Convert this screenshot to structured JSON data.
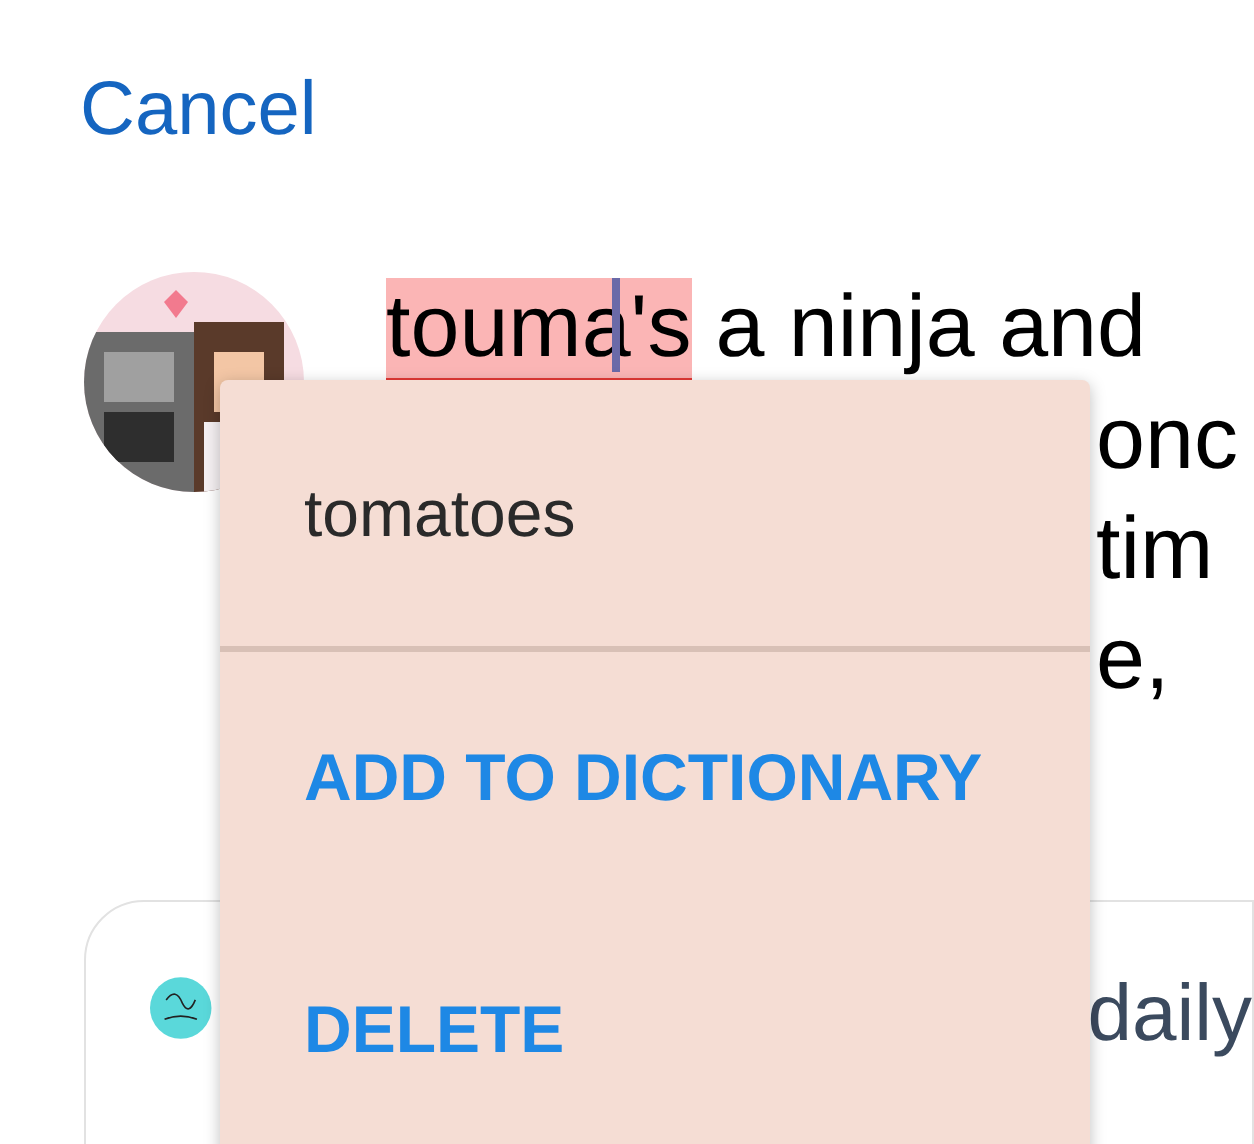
{
  "header": {
    "cancel": "Cancel"
  },
  "post": {
    "misspelled_word": "touma's",
    "rest_of_line": "a ninja and",
    "visible_fragments": [
      "onc",
      "tim",
      "e,"
    ]
  },
  "quoted_card": {
    "text": "daily"
  },
  "spell_menu": {
    "suggestions": [
      "tomatoes"
    ],
    "actions": [
      "ADD TO DICTIONARY",
      "DELETE"
    ]
  }
}
